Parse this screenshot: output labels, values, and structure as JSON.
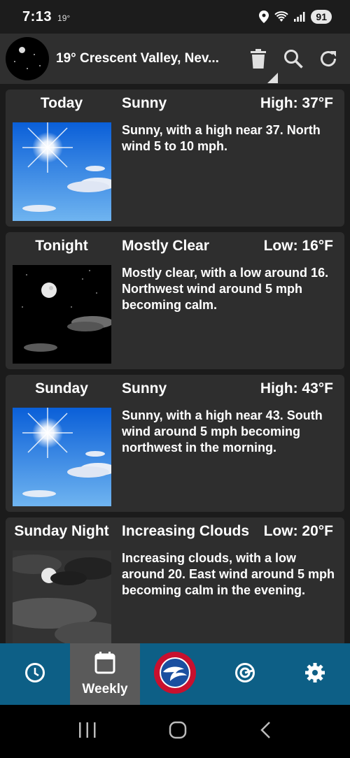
{
  "status_bar": {
    "time": "7:13",
    "temperature": "19°",
    "battery": "91",
    "icons": [
      "location-icon",
      "wifi-icon",
      "signal-icon"
    ]
  },
  "header": {
    "title": "19°  Crescent Valley, Nev...",
    "actions": [
      "trash-icon",
      "search-icon",
      "refresh-icon"
    ]
  },
  "forecast": [
    {
      "period": "Today",
      "short": "Sunny",
      "temp": "High: 37°F",
      "detail": "Sunny, with a high near 37. North wind 5 to 10 mph.",
      "icon": "sunny-icon"
    },
    {
      "period": "Tonight",
      "short": "Mostly Clear",
      "temp": "Low: 16°F",
      "detail": "Mostly clear, with a low around 16. Northwest wind around 5 mph becoming calm.",
      "icon": "night-clear-icon"
    },
    {
      "period": "Sunday",
      "short": "Sunny",
      "temp": "High: 43°F",
      "detail": "Sunny, with a high near 43. South wind around 5 mph becoming northwest in the morning.",
      "icon": "sunny-icon"
    },
    {
      "period": "Sunday Night",
      "short": "Increasing Clouds",
      "temp": "Low: 20°F",
      "detail": "Increasing clouds, with a low around 20. East wind around 5 mph becoming calm  in the evening.",
      "icon": "night-cloudy-icon"
    }
  ],
  "bottom_nav": {
    "tabs": [
      {
        "name": "clock-icon",
        "label": ""
      },
      {
        "name": "calendar-icon",
        "label": "Weekly"
      },
      {
        "name": "nws-logo",
        "label": ""
      },
      {
        "name": "radar-icon",
        "label": ""
      },
      {
        "name": "gear-icon",
        "label": ""
      }
    ],
    "active": "Weekly",
    "color": "#0d5f86"
  },
  "system_nav": [
    "recents-icon",
    "home-icon",
    "back-icon"
  ]
}
